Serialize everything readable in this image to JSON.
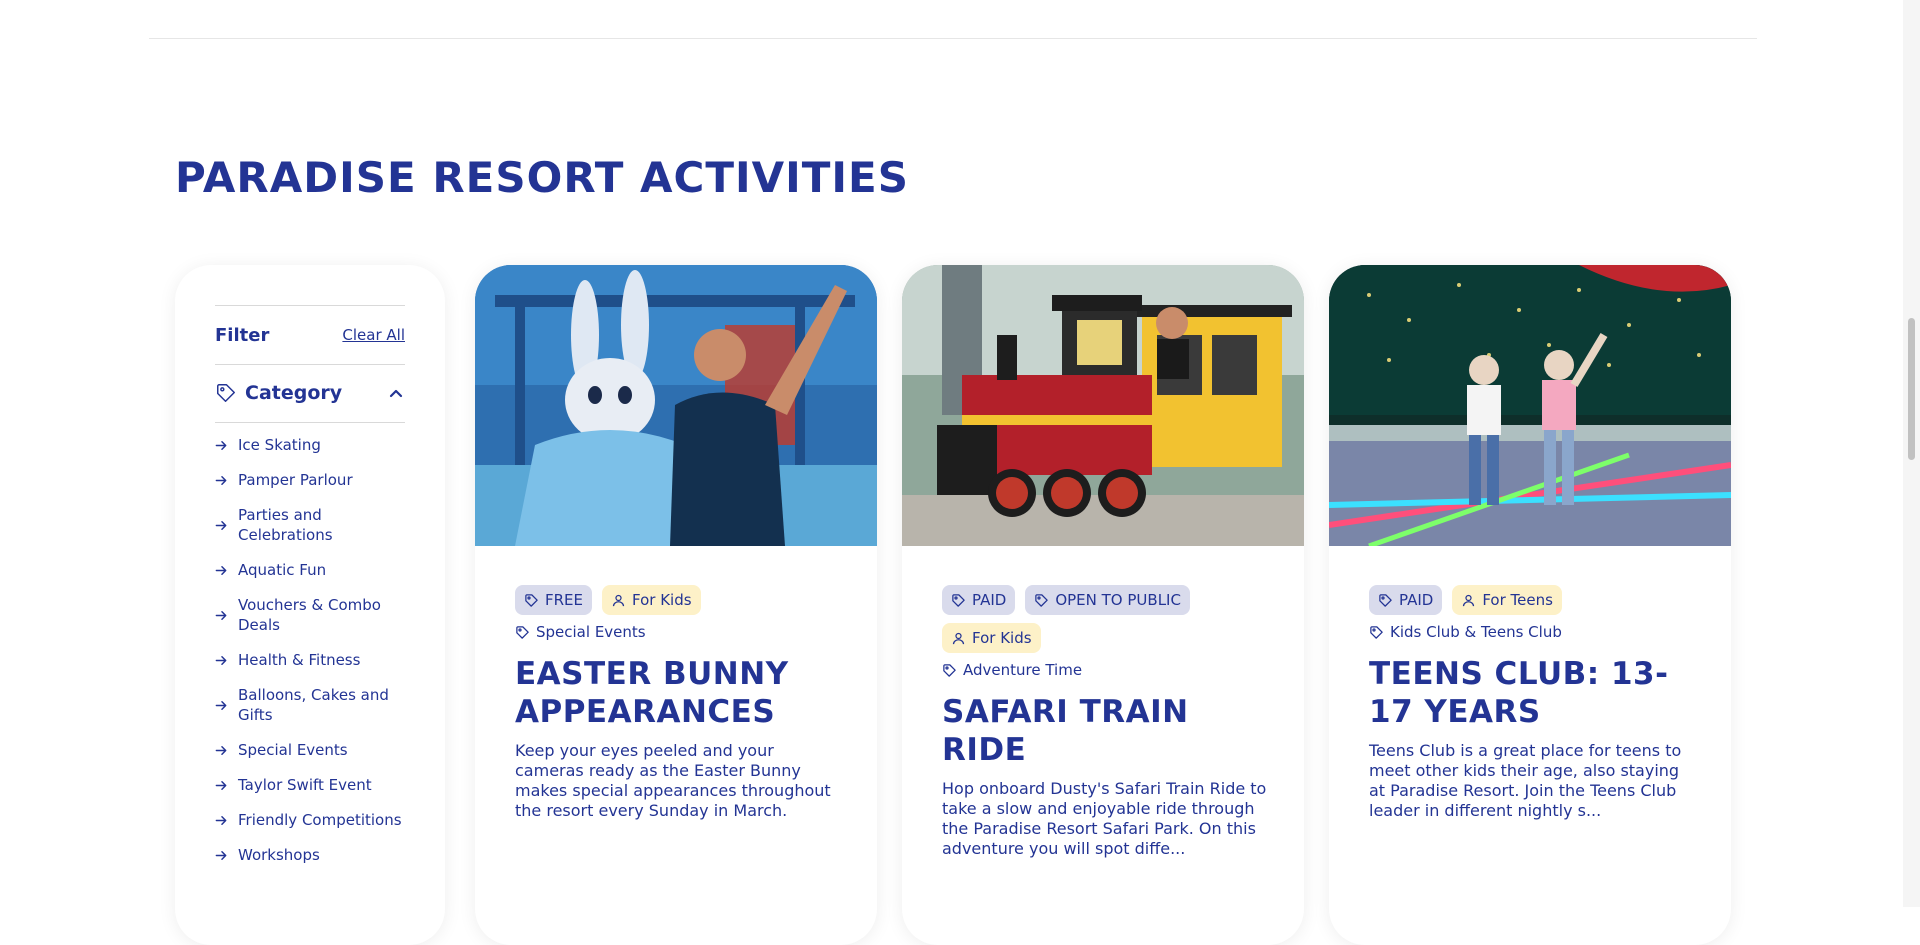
{
  "page_title": "PARADISE RESORT ACTIVITIES",
  "filter": {
    "label": "Filter",
    "clear_all": "Clear All",
    "category_heading": "Category",
    "categories": [
      "Ice Skating",
      "Pamper Parlour",
      "Parties and Celebrations",
      "Aquatic Fun",
      "Vouchers & Combo Deals",
      "Health & Fitness",
      "Balloons, Cakes and Gifts",
      "Special Events",
      "Taylor Swift Event",
      "Friendly Competitions",
      "Workshops"
    ]
  },
  "cards": [
    {
      "badges": [
        "FREE",
        "For Kids"
      ],
      "category": "Special Events",
      "title": "EASTER BUNNY APPEARANCES",
      "description": "Keep your eyes peeled and your cameras ready as the Easter Bunny makes special appearances throughout the resort every Sunday in March."
    },
    {
      "badges": [
        "PAID",
        "OPEN TO PUBLIC",
        "For Kids"
      ],
      "category": "Adventure Time",
      "title": "SAFARI TRAIN RIDE",
      "description": "Hop onboard Dusty's Safari Train Ride to take a slow and enjoyable ride through the Paradise Resort Safari Park. On this adventure you will spot diffe..."
    },
    {
      "badges": [
        "PAID",
        "For Teens"
      ],
      "category": "Kids Club & Teens Club",
      "title": "TEENS CLUB: 13-17 YEARS",
      "description": "Teens Club is a great place for teens to meet other kids their age, also staying at Paradise Resort. Join the Teens Club leader in different nightly s..."
    }
  ],
  "colors": {
    "brand_navy": "#233494",
    "price_badge_bg": "#d9dbec",
    "audience_badge_bg": "#fdf1c8"
  },
  "icons": [
    "tag-icon",
    "chevron-up-icon",
    "arrow-right-icon",
    "person-icon"
  ]
}
